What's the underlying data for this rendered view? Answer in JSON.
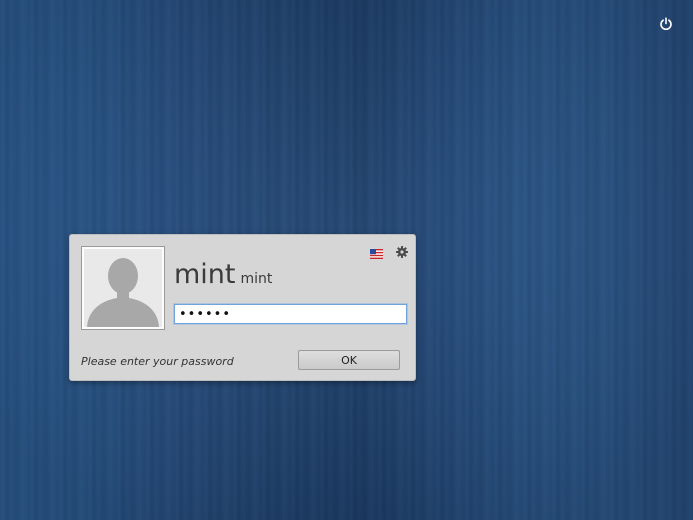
{
  "login": {
    "display_name": "mint",
    "username": "mint",
    "password_masked": "••••••",
    "prompt": "Please enter your password",
    "ok_label": "OK"
  },
  "icons": {
    "power": "power-icon",
    "language": "us-flag-icon",
    "settings": "gear-icon",
    "avatar": "user-silhouette"
  },
  "colors": {
    "background": "#234b7c",
    "panel": "#d6d6d6",
    "field_focus_border": "#6fa4dd",
    "text": "#3b3b3b"
  }
}
